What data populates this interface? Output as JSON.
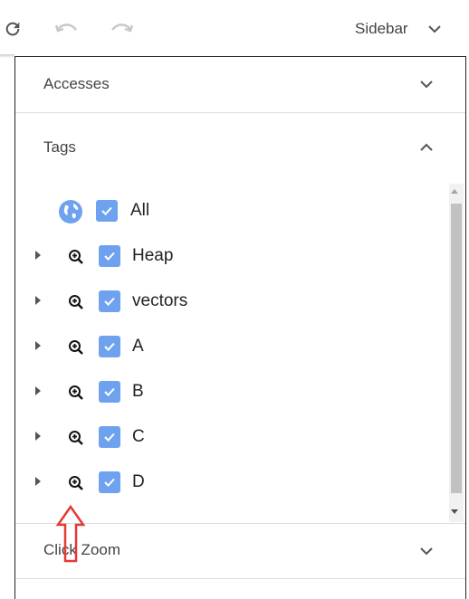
{
  "toolbar": {
    "refresh_icon": "refresh-icon",
    "undo_icon": "undo-icon",
    "redo_icon": "redo-icon",
    "sidebar_label": "Sidebar"
  },
  "sections": {
    "accesses": "Accesses",
    "tags": "Tags",
    "click_zoom": "Click Zoom"
  },
  "tags": {
    "items": [
      {
        "label": "All",
        "checked": true,
        "icon": "globe-icon"
      },
      {
        "label": "Heap",
        "checked": true,
        "icon": "zoom-in-icon"
      },
      {
        "label": "vectors",
        "checked": true,
        "icon": "zoom-in-icon"
      },
      {
        "label": "A",
        "checked": true,
        "icon": "zoom-in-icon"
      },
      {
        "label": "B",
        "checked": true,
        "icon": "zoom-in-icon"
      },
      {
        "label": "C",
        "checked": true,
        "icon": "zoom-in-icon"
      },
      {
        "label": "D",
        "checked": true,
        "icon": "zoom-in-icon"
      }
    ]
  },
  "colors": {
    "checkbox": "#6ea2ef",
    "globe": "#6ea2ef",
    "annotation_arrow": "#e53935"
  }
}
